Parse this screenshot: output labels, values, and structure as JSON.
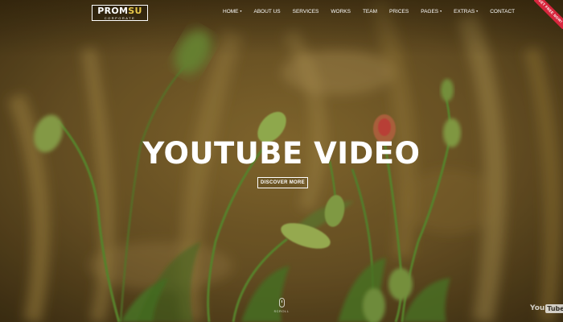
{
  "header": {
    "logo": {
      "main_a": "PROM",
      "main_b": "SU",
      "sub": "CORPORATE"
    },
    "nav": [
      {
        "label": "HOME",
        "dropdown": true
      },
      {
        "label": "ABOUT US",
        "dropdown": false
      },
      {
        "label": "SERVICES",
        "dropdown": false
      },
      {
        "label": "WORKS",
        "dropdown": false
      },
      {
        "label": "TEAM",
        "dropdown": false
      },
      {
        "label": "PRICES",
        "dropdown": false
      },
      {
        "label": "PAGES",
        "dropdown": true
      },
      {
        "label": "EXTRAS",
        "dropdown": true
      },
      {
        "label": "CONTACT",
        "dropdown": false
      }
    ],
    "ribbon": "GET FREE NOW!"
  },
  "hero": {
    "title": "YOUTUBE VIDEO",
    "button_label": "DISCOVER MORE",
    "scroll_label": "SCROLL"
  },
  "video": {
    "logo_you": "You",
    "logo_tube": "Tube"
  },
  "colors": {
    "background": "#6b5526",
    "ribbon": "#d7263d",
    "logo_accent": "#e8c94a",
    "text": "#ffffff"
  },
  "icons": {
    "caret": "caret-down-icon",
    "scroll": "mouse-icon"
  }
}
